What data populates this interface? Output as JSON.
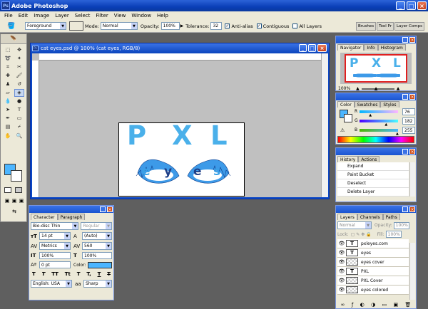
{
  "app": {
    "title": "Adobe Photoshop"
  },
  "menu": [
    "File",
    "Edit",
    "Image",
    "Layer",
    "Select",
    "Filter",
    "View",
    "Window",
    "Help"
  ],
  "options": {
    "tool_preset": "",
    "fill_source": "Foreground",
    "mode_label": "Mode:",
    "mode_value": "Normal",
    "opacity_label": "Opacity:",
    "opacity_value": "100%",
    "tolerance_label": "Tolerance:",
    "tolerance_value": "32",
    "antialias_label": "Anti-alias",
    "contiguous_label": "Contiguous",
    "all_layers_label": "All Layers",
    "well_tabs": [
      "Brushes",
      "Tool Pr",
      "Layer Comps"
    ]
  },
  "document": {
    "title": "cat eyes.psd @ 100% (cat eyes, RGB/8)",
    "logo_letters": [
      "P",
      "X",
      "L"
    ],
    "sub_letters": [
      "e",
      "y",
      "e",
      "s"
    ]
  },
  "navigator": {
    "tabs": [
      "Navigator",
      "Info",
      "Histogram"
    ],
    "zoom": "100%"
  },
  "color": {
    "tabs": [
      "Color",
      "Swatches",
      "Styles"
    ],
    "r_label": "R",
    "g_label": "G",
    "b_label": "B",
    "r": "76",
    "g": "182",
    "b": "255",
    "swatch": "#4cb6ff",
    "r_fraction": 0.3,
    "g_fraction": 0.71,
    "b_fraction": 1.0
  },
  "history": {
    "tabs": [
      "History",
      "Actions"
    ],
    "items": [
      "Expand",
      "Paint Bucket",
      "Deselect",
      "Delete Layer"
    ]
  },
  "character": {
    "tabs": [
      "Character",
      "Paragraph"
    ],
    "font": "Bio-disc Thin",
    "style": "Regular",
    "size": "14 pt",
    "leading": "(Auto)",
    "kerning": "Metrics",
    "tracking": "560",
    "vscale": "100%",
    "hscale": "100%",
    "baseline": "0 pt",
    "color_label": "Color:",
    "color": "#4cb6ff",
    "styles": [
      "T",
      "T",
      "TT",
      "Tt",
      "T",
      "T,",
      "T",
      "T"
    ],
    "language": "English: USA",
    "antialias": "Sharp",
    "aa_icon": "aa"
  },
  "layers": {
    "tabs": [
      "Layers",
      "Channels",
      "Paths"
    ],
    "blend": "Normal",
    "opacity_label": "Opacity:",
    "opacity": "100%",
    "lock_label": "Lock:",
    "fill_label": "Fill:",
    "fill": "100%",
    "items": [
      {
        "name": "pxleyes.com",
        "kind": "T"
      },
      {
        "name": "eyes",
        "kind": "T"
      },
      {
        "name": "eyes cover",
        "kind": "img"
      },
      {
        "name": "PXL",
        "kind": "T"
      },
      {
        "name": "PXL Cover",
        "kind": "img"
      },
      {
        "name": "eyes colored",
        "kind": "img"
      }
    ]
  },
  "tool_foreground": "#4cb6ff"
}
